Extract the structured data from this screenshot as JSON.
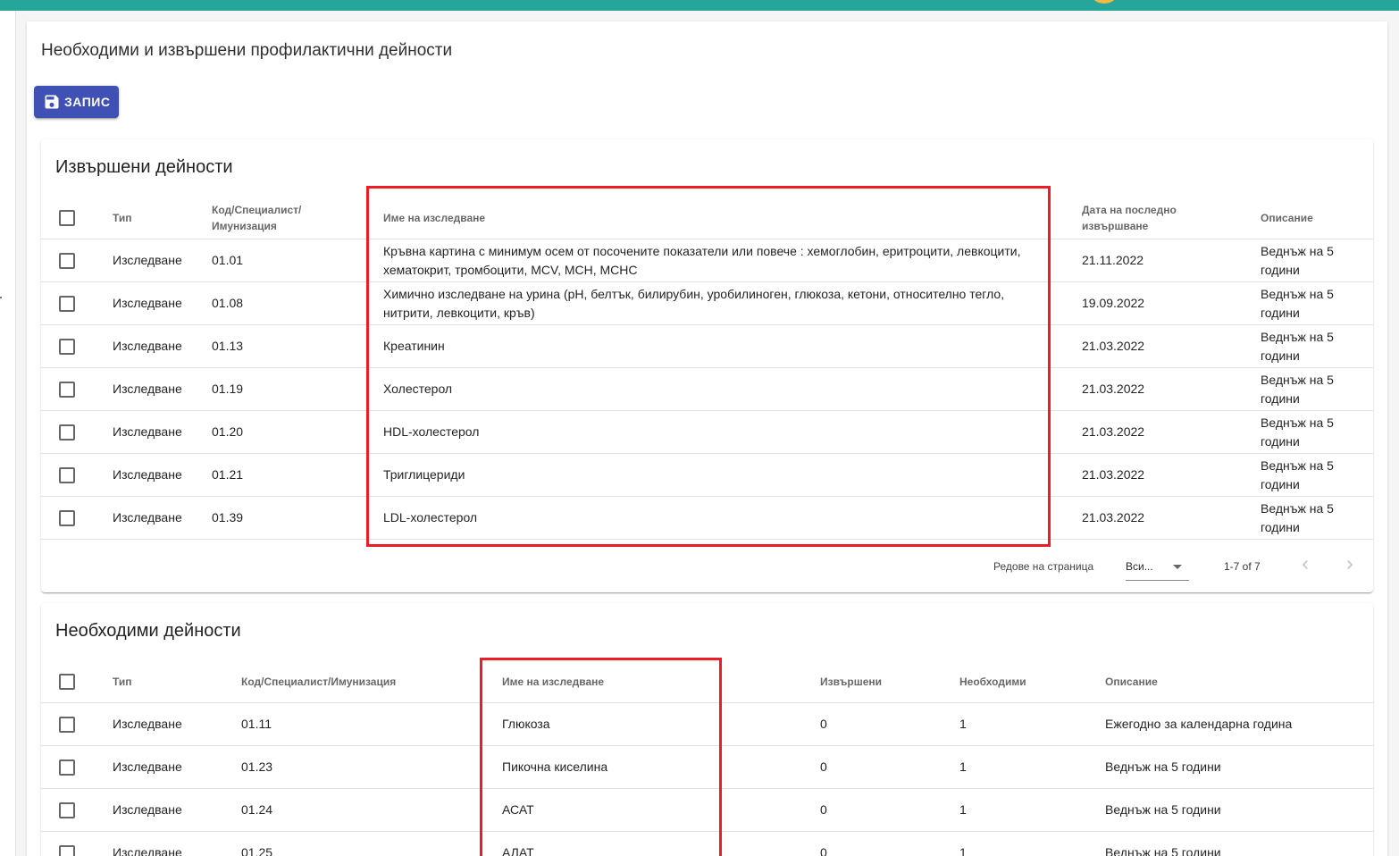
{
  "page": {
    "title": "Необходими и извършени профилактични дейности",
    "save_label": "ЗАПИС"
  },
  "performed": {
    "title": "Извършени дейности",
    "headers": {
      "type": "Тип",
      "code_line1": "Код/Специалист/",
      "code_line2": "Имунизация",
      "name": "Име на изследване",
      "date_line1": "Дата на последно",
      "date_line2": "извършване",
      "description": "Описание"
    },
    "rows": [
      {
        "type": "Изследване",
        "code": "01.01",
        "name": "Кръвна картина с минимум осем от посочените показатели или повече : хемоглобин, еритроцити, левкоцити, хематокрит, тромбоцити, MCV, MCH, MCHC",
        "date": "21.11.2022",
        "description": "Веднъж на 5 години"
      },
      {
        "type": "Изследване",
        "code": "01.08",
        "name": "Химично изследване на урина (pH, белтък, билирубин, уробилиноген, глюкоза, кетони, относително тегло, нитрити, левкоцити, кръв)",
        "date": "19.09.2022",
        "description": "Веднъж на 5 години"
      },
      {
        "type": "Изследване",
        "code": "01.13",
        "name": "Креатинин",
        "date": "21.03.2022",
        "description": "Веднъж на 5 години"
      },
      {
        "type": "Изследване",
        "code": "01.19",
        "name": "Холестерол",
        "date": "21.03.2022",
        "description": "Веднъж на 5 години"
      },
      {
        "type": "Изследване",
        "code": "01.20",
        "name": "HDL-холестерол",
        "date": "21.03.2022",
        "description": "Веднъж на 5 години"
      },
      {
        "type": "Изследване",
        "code": "01.21",
        "name": "Триглицериди",
        "date": "21.03.2022",
        "description": "Веднъж на 5 години"
      },
      {
        "type": "Изследване",
        "code": "01.39",
        "name": "LDL-холестерол",
        "date": "21.03.2022",
        "description": "Веднъж на 5 години"
      }
    ],
    "footer": {
      "rows_per_page_label": "Редове на страница",
      "rows_per_page_value": "Вси...",
      "range": "1-7 of 7"
    }
  },
  "required": {
    "title": "Необходими дейности",
    "headers": {
      "type": "Тип",
      "code": "Код/Специалист/Имунизация",
      "name": "Име на изследване",
      "performed": "Извършени",
      "required": "Необходими",
      "description": "Описание"
    },
    "rows": [
      {
        "type": "Изследване",
        "code": "01.11",
        "name": "Глюкоза",
        "performed": "0",
        "required": "1",
        "description": "Ежегодно за календарна година"
      },
      {
        "type": "Изследване",
        "code": "01.23",
        "name": "Пикочна киселина",
        "performed": "0",
        "required": "1",
        "description": "Веднъж на 5 години"
      },
      {
        "type": "Изследване",
        "code": "01.24",
        "name": "АСАТ",
        "performed": "0",
        "required": "1",
        "description": "Веднъж на 5 години"
      },
      {
        "type": "Изследване",
        "code": "01.25",
        "name": "АЛАТ",
        "performed": "0",
        "required": "1",
        "description": "Веднъж на 5 години"
      }
    ]
  },
  "colors": {
    "topbar": "#26a69a",
    "primary_button": "#3f51b5",
    "highlight": "#ee1c24"
  }
}
